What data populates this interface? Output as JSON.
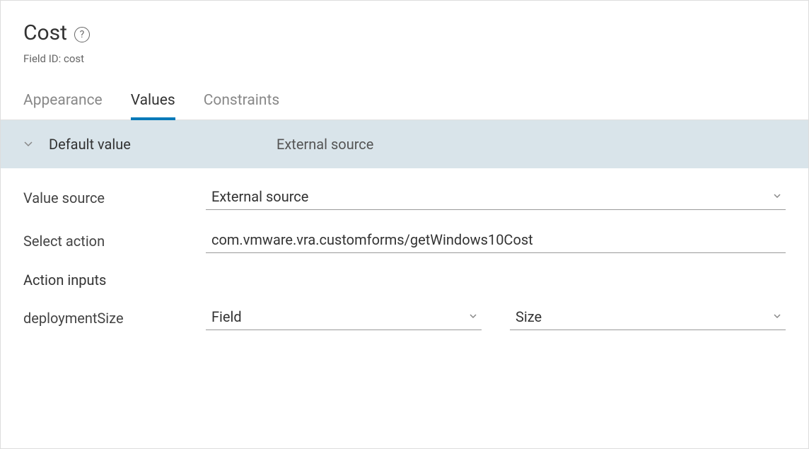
{
  "header": {
    "title": "Cost",
    "helpSymbol": "?",
    "fieldIdLabel": "Field ID:",
    "fieldIdValue": "cost"
  },
  "tabs": {
    "appearance": "Appearance",
    "values": "Values",
    "constraints": "Constraints"
  },
  "section": {
    "label": "Default value",
    "value": "External source"
  },
  "form": {
    "valueSource": {
      "label": "Value source",
      "selected": "External source"
    },
    "selectAction": {
      "label": "Select action",
      "value": "com.vmware.vra.customforms/getWindows10Cost"
    },
    "actionInputs": {
      "label": "Action inputs"
    },
    "deploymentSize": {
      "label": "deploymentSize",
      "type": "Field",
      "value": "Size"
    }
  }
}
